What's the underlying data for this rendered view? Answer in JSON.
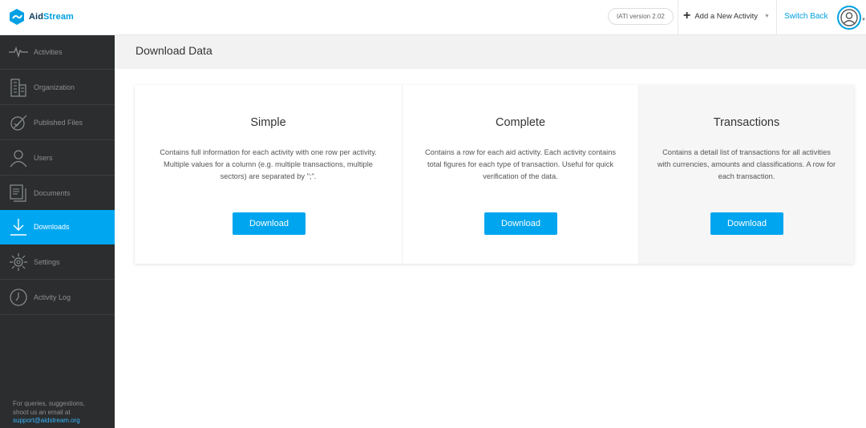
{
  "brand": {
    "name_part1": "Aid",
    "name_part2": "Stream"
  },
  "header": {
    "version": "IATI version 2.02",
    "add_activity": "Add a New Activity",
    "switch_back": "Switch Back"
  },
  "sidebar": {
    "items": [
      {
        "label": "Activities",
        "icon": "pulse-icon"
      },
      {
        "label": "Organization",
        "icon": "building-icon"
      },
      {
        "label": "Published Files",
        "icon": "published-icon"
      },
      {
        "label": "Users",
        "icon": "user-icon"
      },
      {
        "label": "Documents",
        "icon": "documents-icon"
      },
      {
        "label": "Downloads",
        "icon": "download-icon",
        "active": true
      },
      {
        "label": "Settings",
        "icon": "gear-icon"
      },
      {
        "label": "Activity Log",
        "icon": "clock-icon"
      }
    ],
    "footer_line1": "For queries, suggestions,",
    "footer_line2": "shoot us an email at",
    "footer_email": "support@aidstream.org"
  },
  "page": {
    "title": "Download Data",
    "cards": [
      {
        "title": "Simple",
        "description": "Contains full information for each activity with one row per activity. Multiple values for a column (e.g. multiple transactions, multiple sectors) are separated by \";\".",
        "button": "Download"
      },
      {
        "title": "Complete",
        "description": "Contains a row for each aid activity. Each activity contains total figures for each type of transaction. Useful for quick verification of the data.",
        "button": "Download"
      },
      {
        "title": "Transactions",
        "description": "Contains a detail list of transactions for all activities with currencies, amounts and classifications. A row for each transaction.",
        "button": "Download"
      }
    ]
  },
  "colors": {
    "accent": "#00a5ef",
    "sidebar_bg": "#2b2d2e",
    "brand_dark": "#0a3a5c"
  }
}
